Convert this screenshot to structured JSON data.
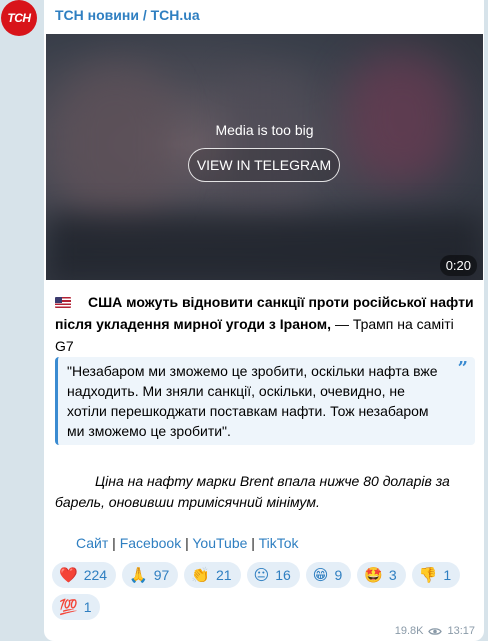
{
  "channel": {
    "avatar_text": "ТСН",
    "name": "ТСН новини / TCH.ua"
  },
  "media": {
    "message": "Media is too big",
    "button_label": "VIEW IN TELEGRAM",
    "duration": "0:20"
  },
  "post": {
    "flag_icon": "us-flag-icon",
    "headline_bold": "США можуть відновити санкції проти російської нафти після укладення мирної угоди з Іраном,",
    "headline_rest": " — Трамп на саміті G7",
    "quote": "\"Незабаром ми зможемо це зробити, оскільки нафта вже надходить. Ми зняли санкції, оскільки, очевидно, не хотіли перешкоджати поставкам нафти. Тож незабаром ми зможемо це зробити\".",
    "price_note": "Ціна на нафту марки Brent впала нижче 80 доларів за барель, оновивши тримісячний мінімум."
  },
  "links": {
    "site": "Сайт",
    "facebook": "Facebook",
    "youtube": "YouTube",
    "tiktok": "TikTok",
    "separator": " | "
  },
  "reactions": [
    {
      "emoji": "❤️",
      "icon": "heart-icon",
      "count": "224"
    },
    {
      "emoji": "🙏",
      "icon": "pray-icon",
      "count": "97"
    },
    {
      "emoji": "👏",
      "icon": "clap-icon",
      "count": "21"
    },
    {
      "emoji": "😐",
      "icon": "neutral-face-icon",
      "count": "16"
    },
    {
      "emoji": "😁",
      "icon": "grin-icon",
      "count": "9"
    },
    {
      "emoji": "🤩",
      "icon": "star-struck-icon",
      "count": "3"
    },
    {
      "emoji": "👎",
      "icon": "thumbs-down-icon",
      "count": "1"
    },
    {
      "emoji": "💯",
      "icon": "hundred-icon",
      "count": "1"
    }
  ],
  "meta": {
    "views": "19.8K",
    "time": "13:17"
  },
  "colors": {
    "link": "#2f7fc1",
    "quote_border": "#3a8bd1",
    "avatar_bg": "#d8141a"
  }
}
